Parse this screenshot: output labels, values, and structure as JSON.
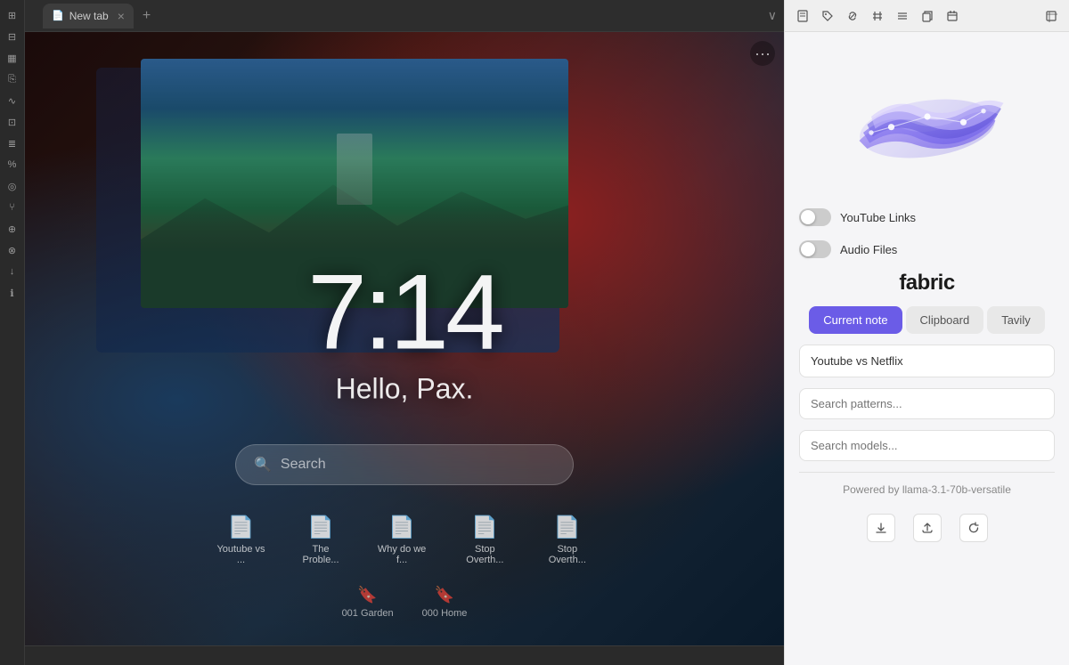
{
  "browser": {
    "tab_label": "New tab",
    "tab_new": "+",
    "tab_dropdown": "∨"
  },
  "sidebar": {
    "icons": [
      {
        "name": "grid-icon",
        "symbol": "⊞"
      },
      {
        "name": "apps-icon",
        "symbol": "⊟"
      },
      {
        "name": "calendar-icon",
        "symbol": "▦"
      },
      {
        "name": "file-icon",
        "symbol": "⎘"
      },
      {
        "name": "wave-icon",
        "symbol": "∿"
      },
      {
        "name": "layout-icon",
        "symbol": "⊡"
      },
      {
        "name": "text-icon",
        "symbol": "≣"
      },
      {
        "name": "percent-icon",
        "symbol": "%"
      },
      {
        "name": "clock-icon",
        "symbol": "○"
      },
      {
        "name": "fork-icon",
        "symbol": "⑂"
      },
      {
        "name": "bag-icon",
        "symbol": "⊕"
      },
      {
        "name": "person-icon",
        "symbol": "⊗"
      },
      {
        "name": "download-icon",
        "symbol": "↓"
      },
      {
        "name": "info-icon",
        "symbol": "ℹ"
      }
    ]
  },
  "clock": {
    "time": "7:14",
    "greeting": "Hello, Pax."
  },
  "search": {
    "placeholder": "Search"
  },
  "recent_files": [
    {
      "name": "Youtube vs ...",
      "icon": "📄"
    },
    {
      "name": "The Proble...",
      "icon": "📄"
    },
    {
      "name": "Why do we f...",
      "icon": "📄"
    },
    {
      "name": "Stop Overth...",
      "icon": "📄"
    },
    {
      "name": "Stop Overth...",
      "icon": "📄"
    }
  ],
  "bookmarks": [
    {
      "name": "001 Garden",
      "icon": "🔖"
    },
    {
      "name": "000 Home",
      "icon": "🔖"
    }
  ],
  "right_toolbar": {
    "icons": [
      {
        "name": "file-toolbar-icon",
        "symbol": "📄"
      },
      {
        "name": "tag-icon",
        "symbol": "⬡"
      },
      {
        "name": "link-icon",
        "symbol": "⬡"
      },
      {
        "name": "hash-icon",
        "symbol": "#"
      },
      {
        "name": "menu-icon",
        "symbol": "☰"
      },
      {
        "name": "copy-icon",
        "symbol": "⊞"
      },
      {
        "name": "calendar-toolbar-icon",
        "symbol": "▦"
      },
      {
        "name": "expand-icon",
        "symbol": "⬜"
      }
    ]
  },
  "fabric": {
    "brand": "fabric",
    "toggles": [
      {
        "label": "YouTube Links",
        "enabled": false
      },
      {
        "label": "Audio Files",
        "enabled": false
      }
    ],
    "tabs": [
      {
        "label": "Current note",
        "active": true
      },
      {
        "label": "Clipboard",
        "active": false
      },
      {
        "label": "Tavily",
        "active": false
      }
    ],
    "note_value": "Youtube vs Netflix",
    "search_patterns_placeholder": "Search patterns...",
    "search_models_placeholder": "Search models...",
    "powered_by": "Powered by llama-3.1-70b-versatile",
    "bottom_icons": [
      {
        "name": "download-bottom-icon",
        "symbol": "↓"
      },
      {
        "name": "upload-bottom-icon",
        "symbol": "↑"
      },
      {
        "name": "refresh-bottom-icon",
        "symbol": "↻"
      }
    ]
  }
}
